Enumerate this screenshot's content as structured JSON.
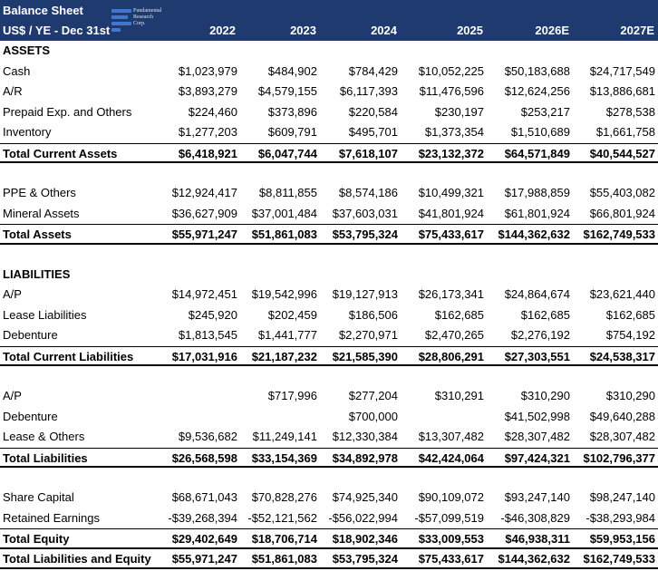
{
  "header": {
    "title": "Balance Sheet",
    "subtitle": "US$ / YE - Dec 31st",
    "logo_text": [
      "Fundamental",
      "Research",
      "Corp."
    ],
    "years": [
      "2022",
      "2023",
      "2024",
      "2025",
      "2026E",
      "2027E"
    ],
    "bg_color": "#1f3a6e"
  },
  "assets_section": "ASSETS",
  "assets_current": [
    {
      "label": "Cash",
      "values": [
        "$1,023,979",
        "$484,902",
        "$784,429",
        "$10,052,225",
        "$50,183,688",
        "$24,717,549"
      ]
    },
    {
      "label": "A/R",
      "values": [
        "$3,893,279",
        "$4,579,155",
        "$6,117,393",
        "$11,476,596",
        "$12,624,256",
        "$13,886,681"
      ]
    },
    {
      "label": "Prepaid Exp. and Others",
      "values": [
        "$224,460",
        "$373,896",
        "$220,584",
        "$230,197",
        "$253,217",
        "$278,538"
      ]
    },
    {
      "label": "Inventory",
      "values": [
        "$1,277,203",
        "$609,791",
        "$495,701",
        "$1,373,354",
        "$1,510,689",
        "$1,661,758"
      ]
    }
  ],
  "total_current_assets": {
    "label": "Total Current Assets",
    "values": [
      "$6,418,921",
      "$6,047,744",
      "$7,618,107",
      "$23,132,372",
      "$64,571,849",
      "$40,544,527"
    ]
  },
  "assets_noncurrent": [
    {
      "label": "PPE & Others",
      "values": [
        "$12,924,417",
        "$8,811,855",
        "$8,574,186",
        "$10,499,321",
        "$17,988,859",
        "$55,403,082"
      ]
    },
    {
      "label": "Mineral Assets",
      "values": [
        "$36,627,909",
        "$37,001,484",
        "$37,603,031",
        "$41,801,924",
        "$61,801,924",
        "$66,801,924"
      ]
    }
  ],
  "total_assets": {
    "label": "Total Assets",
    "values": [
      "$55,971,247",
      "$51,861,083",
      "$53,795,324",
      "$75,433,617",
      "$144,362,632",
      "$162,749,533"
    ]
  },
  "liabilities_section": "LIABILITIES",
  "liabilities_current": [
    {
      "label": "A/P",
      "values": [
        "$14,972,451",
        "$19,542,996",
        "$19,127,913",
        "$26,173,341",
        "$24,864,674",
        "$23,621,440"
      ]
    },
    {
      "label": "Lease Liabilities",
      "values": [
        "$245,920",
        "$202,459",
        "$186,506",
        "$162,685",
        "$162,685",
        "$162,685"
      ]
    },
    {
      "label": "Debenture",
      "values": [
        "$1,813,545",
        "$1,441,777",
        "$2,270,971",
        "$2,470,265",
        "$2,276,192",
        "$754,192"
      ]
    }
  ],
  "total_current_liabilities": {
    "label": "Total Current Liabilities",
    "values": [
      "$17,031,916",
      "$21,187,232",
      "$21,585,390",
      "$28,806,291",
      "$27,303,551",
      "$24,538,317"
    ]
  },
  "liabilities_noncurrent": [
    {
      "label": "A/P",
      "values": [
        "",
        "$717,996",
        "$277,204",
        "$310,291",
        "$310,290",
        "$310,290"
      ]
    },
    {
      "label": "Debenture",
      "values": [
        "",
        "",
        "$700,000",
        "",
        "$41,502,998",
        "$49,640,288"
      ]
    },
    {
      "label": "Lease & Others",
      "values": [
        "$9,536,682",
        "$11,249,141",
        "$12,330,384",
        "$13,307,482",
        "$28,307,482",
        "$28,307,482"
      ]
    }
  ],
  "total_liabilities": {
    "label": "Total Liabilities",
    "values": [
      "$26,568,598",
      "$33,154,369",
      "$34,892,978",
      "$42,424,064",
      "$97,424,321",
      "$102,796,377"
    ]
  },
  "equity": [
    {
      "label": "Share Capital",
      "values": [
        "$68,671,043",
        "$70,828,276",
        "$74,925,340",
        "$90,109,072",
        "$93,247,140",
        "$98,247,140"
      ]
    },
    {
      "label": "Retained Earnings",
      "values": [
        "-$39,268,394",
        "-$52,121,562",
        "-$56,022,994",
        "-$57,099,519",
        "-$46,308,829",
        "-$38,293,984"
      ]
    }
  ],
  "total_equity": {
    "label": "Total Equity",
    "values": [
      "$29,402,649",
      "$18,706,714",
      "$18,902,346",
      "$33,009,553",
      "$46,938,311",
      "$59,953,156"
    ]
  },
  "total_liabilities_equity": {
    "label": "Total Liabilities and Equity",
    "values": [
      "$55,971,247",
      "$51,861,083",
      "$53,795,324",
      "$75,433,617",
      "$144,362,632",
      "$162,749,533"
    ]
  }
}
